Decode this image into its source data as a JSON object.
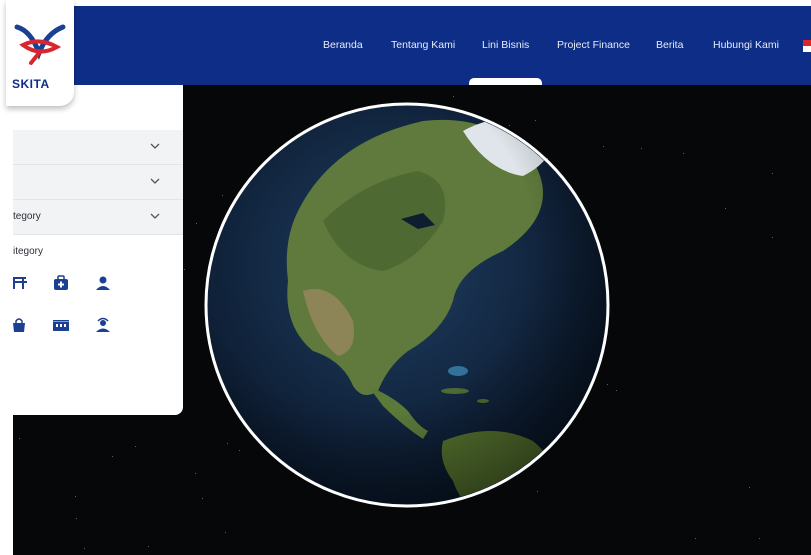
{
  "brand": {
    "logo_text": "SKITA"
  },
  "nav": {
    "items": [
      {
        "label": "Beranda"
      },
      {
        "label": "Tentang Kami"
      },
      {
        "label": "Lini Bisnis"
      },
      {
        "label": "Project Finance"
      },
      {
        "label": "Berita"
      },
      {
        "label": "Hubungi Kami"
      }
    ],
    "active": "Lini Bisnis"
  },
  "filters": {
    "rows": [
      {
        "label": ""
      },
      {
        "label": ""
      },
      {
        "label": "tegory"
      }
    ],
    "category_title": "itegory",
    "category_icons": [
      "bridge-icon",
      "medical-case-icon",
      "person-icon",
      "bag-icon",
      "building-icon",
      "worker-icon"
    ]
  },
  "colors": {
    "nav_bg": "#0d2d86",
    "accent": "#1b3f91",
    "space": "#060709",
    "panel_row": "#f2f3f5"
  }
}
